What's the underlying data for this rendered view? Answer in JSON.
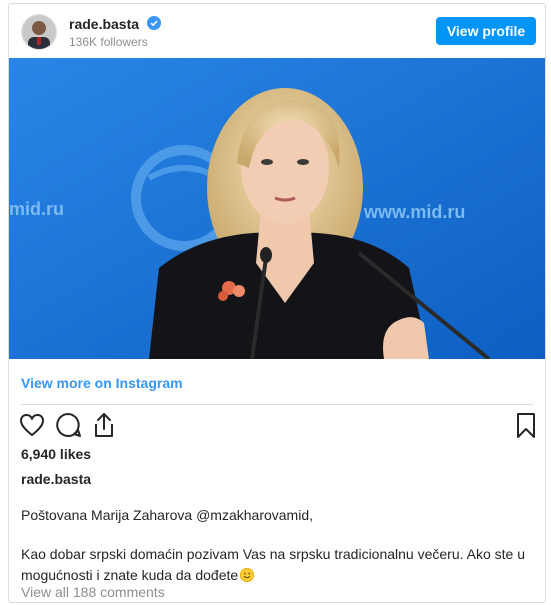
{
  "header": {
    "username": "rade.basta",
    "followers": "136K followers",
    "view_profile_label": "View profile"
  },
  "post": {
    "view_more_label": "View more on Instagram",
    "likes": "6,940 likes",
    "caption_user": "rade.basta",
    "caption_line1": "Poštovana Marija Zaharova @mzakharovamid,",
    "caption_line2": "Kao dobar srpski domaćin pozivam Vas na srpsku tradicionalnu večeru. Ako ste u mogućnosti i znate kuda da dođete",
    "comments_label": "View all 188 comments",
    "photo_text_left": "mid.ru",
    "photo_text_right": "www.mid.ru"
  },
  "icons": {
    "like": "heart-icon",
    "comment": "comment-icon",
    "share": "share-icon",
    "save": "bookmark-icon",
    "verified": "verified-badge-icon",
    "emoji": "smile-emoji-icon"
  },
  "colors": {
    "accent": "#0095f6",
    "link": "#3897f0",
    "photo_background": "#1a73d4"
  }
}
